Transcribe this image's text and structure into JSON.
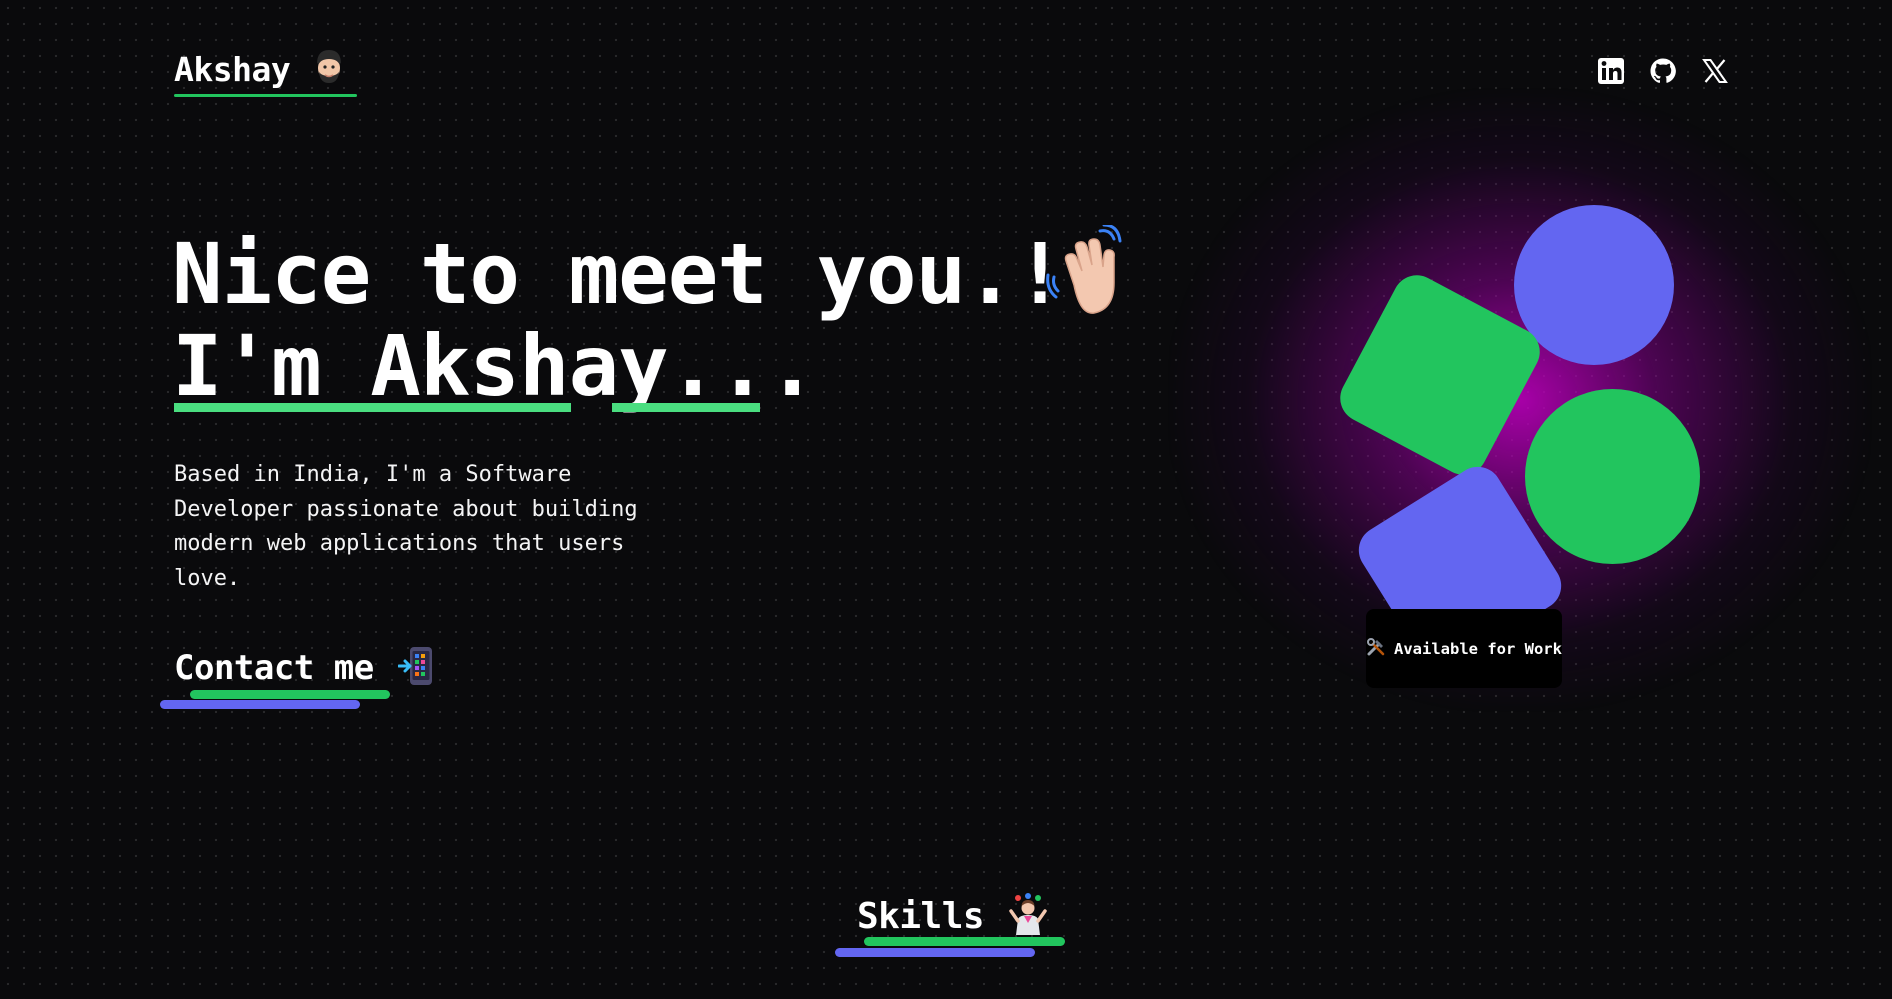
{
  "header": {
    "logo_text": "Akshay",
    "logo_icon": "man-face-emoji",
    "socials": [
      {
        "name": "linkedin-icon"
      },
      {
        "name": "github-icon"
      },
      {
        "name": "x-twitter-icon"
      }
    ]
  },
  "hero": {
    "title_line1": "Nice to meet you.!",
    "title_line2": "I'm Akshay...",
    "wave_icon": "waving-hand-emoji",
    "intro": "Based in India, I'm a Software Developer passionate about building modern web applications that users love.",
    "contact_label": "Contact me",
    "contact_icon": "mobile-phone-arrow-emoji"
  },
  "badge": {
    "icon": "hammer-wrench-emoji",
    "label": "Available for Work"
  },
  "skills": {
    "title": "Skills",
    "icon": "juggling-person-emoji"
  },
  "colors": {
    "background": "#0a0a0c",
    "accent_green": "#22c55e",
    "accent_indigo": "#6366f1",
    "glow_magenta": "#c400c4",
    "text": "#ffffff"
  }
}
